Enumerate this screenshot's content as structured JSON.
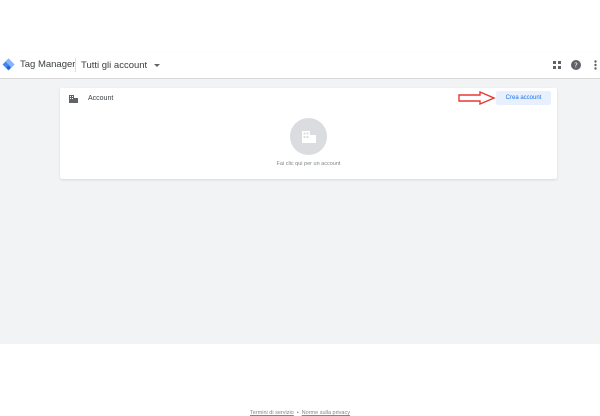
{
  "header": {
    "product_name": "Tag Manager",
    "account_picker_label": "Tutti gli account",
    "icons": [
      "apps-grid-icon",
      "help-icon",
      "more-vert-icon"
    ]
  },
  "card": {
    "title": "Account",
    "create_button_label": "Crea account",
    "empty_text": "Fai clic qui per un account",
    "annotation_arrow_color": "#e53935"
  },
  "footer": {
    "terms_label": "Termini di servizio",
    "separator": "•",
    "privacy_label": "Norme sulla privacy"
  },
  "colors": {
    "accent": "#1a73e8",
    "button_bg": "#e8f0fe",
    "main_bg": "#f1f3f4"
  }
}
